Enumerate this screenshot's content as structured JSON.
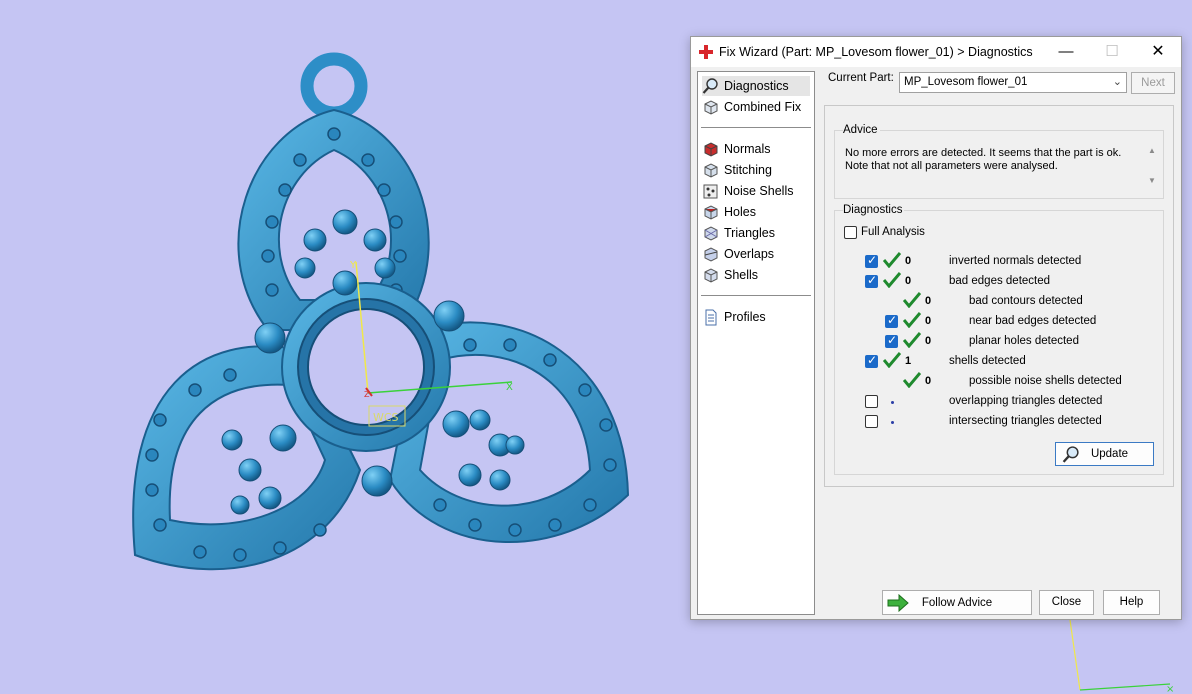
{
  "window": {
    "title": "Fix Wizard (Part: MP_Lovesom flower_01) > Diagnostics",
    "min_glyph": "—",
    "max_glyph": "☐",
    "close_glyph": "✕"
  },
  "nav": {
    "items_top": [
      {
        "label": "Diagnostics",
        "icon": "magnifier-icon",
        "selected": true
      },
      {
        "label": "Combined Fix",
        "icon": "cube-icon"
      }
    ],
    "items_mid": [
      {
        "label": "Normals",
        "icon": "normals-cube-icon"
      },
      {
        "label": "Stitching",
        "icon": "stitching-cube-icon"
      },
      {
        "label": "Noise Shells",
        "icon": "noise-shells-icon"
      },
      {
        "label": "Holes",
        "icon": "holes-cube-icon"
      },
      {
        "label": "Triangles",
        "icon": "triangles-icon"
      },
      {
        "label": "Overlaps",
        "icon": "overlaps-icon"
      },
      {
        "label": "Shells",
        "icon": "shells-icon"
      }
    ],
    "items_bottom": [
      {
        "label": "Profiles",
        "icon": "document-icon"
      }
    ]
  },
  "current_part": {
    "label": "Current Part:",
    "value": "MP_Lovesom flower_01",
    "next_label": "Next"
  },
  "advice": {
    "title": "Advice",
    "text_line1": "No more errors are detected. It seems that the part is ok.",
    "text_line2": "Note that not all parameters were analysed."
  },
  "diagnostics": {
    "title": "Diagnostics",
    "full_analysis_label": "Full Analysis",
    "rows": [
      {
        "checked": true,
        "has_checkbox": true,
        "result": "0",
        "label": "inverted normals detected",
        "indent": 0
      },
      {
        "checked": true,
        "has_checkbox": true,
        "result": "0",
        "label": "bad edges detected",
        "indent": 0
      },
      {
        "checked": false,
        "has_checkbox": false,
        "result": "0",
        "label": "bad contours detected",
        "indent": 1
      },
      {
        "checked": true,
        "has_checkbox": true,
        "result": "0",
        "label": "near bad edges detected",
        "indent": 1
      },
      {
        "checked": true,
        "has_checkbox": true,
        "result": "0",
        "label": "planar holes detected",
        "indent": 1
      },
      {
        "checked": true,
        "has_checkbox": true,
        "result": "1",
        "label": "shells detected",
        "indent": 0
      },
      {
        "checked": false,
        "has_checkbox": false,
        "result": "0",
        "label": "possible noise shells detected",
        "indent": 1
      },
      {
        "checked": false,
        "has_checkbox": true,
        "result": "",
        "label": "overlapping triangles detected",
        "indent": 0
      },
      {
        "checked": false,
        "has_checkbox": true,
        "result": "",
        "label": "intersecting triangles detected",
        "indent": 0
      }
    ],
    "update_label": "Update"
  },
  "footer": {
    "follow_advice_label": "Follow Advice",
    "close_label": "Close",
    "help_label": "Help"
  },
  "viewport": {
    "background": "#c5c5f3",
    "model_color": "#3d9bd0",
    "wcs_label": "WCS",
    "axis_y_label": "Y",
    "axis_x_label": "X",
    "axis_z_label": "Z"
  }
}
